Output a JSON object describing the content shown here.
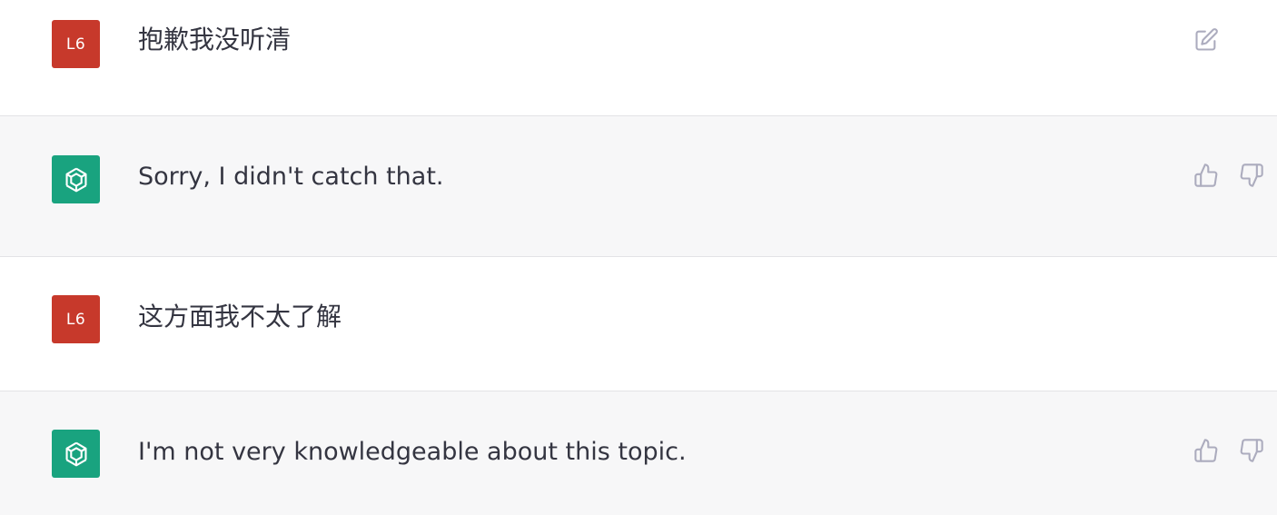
{
  "colors": {
    "user_avatar_bg": "#c7392b",
    "bot_avatar_bg": "#19a37f",
    "assistant_row_bg": "#f7f7f8",
    "text": "#343541",
    "icon": "#acacbe"
  },
  "messages": [
    {
      "role": "user",
      "avatar_label": "L6",
      "text": "抱歉我没听清",
      "actions": [
        "edit-icon"
      ]
    },
    {
      "role": "assistant",
      "avatar_icon": "openai-logo-icon",
      "text": "Sorry, I didn't catch that.",
      "actions": [
        "thumbs-up-icon",
        "thumbs-down-icon"
      ]
    },
    {
      "role": "user",
      "avatar_label": "L6",
      "text": "这方面我不太了解",
      "actions": []
    },
    {
      "role": "assistant",
      "avatar_icon": "openai-logo-icon",
      "text": "I'm not very knowledgeable about this topic.",
      "actions": [
        "thumbs-up-icon",
        "thumbs-down-icon"
      ]
    }
  ]
}
